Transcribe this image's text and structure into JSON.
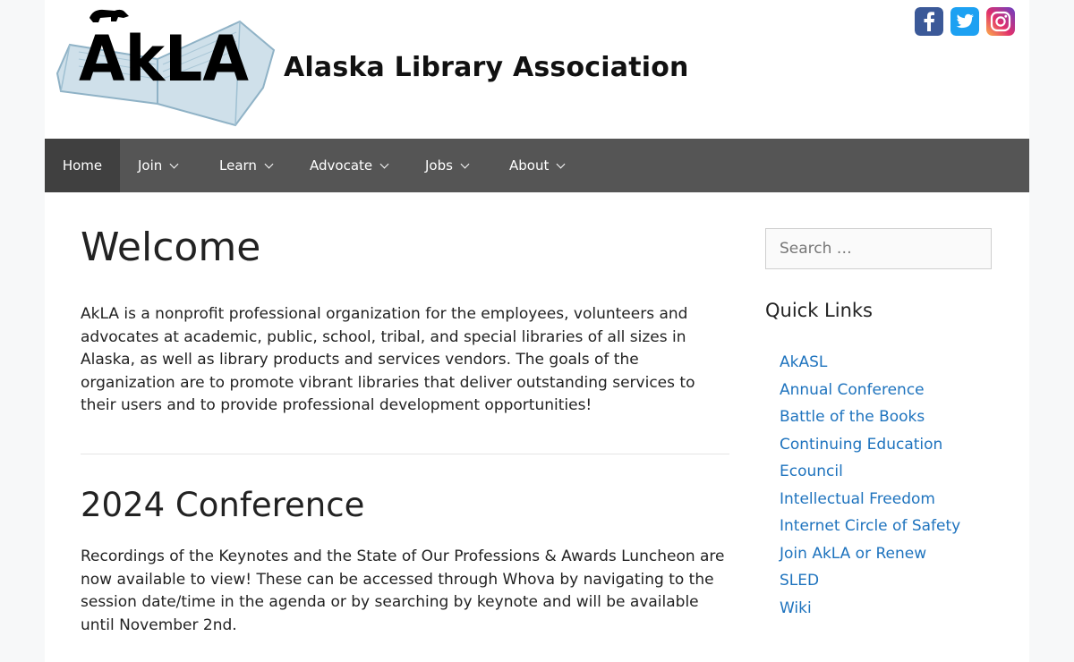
{
  "header": {
    "logo_text": "AkLA",
    "site_title": "Alaska Library Association",
    "social": [
      {
        "name": "facebook",
        "glyph": "f",
        "color": "#3b5998"
      },
      {
        "name": "twitter",
        "glyph": "t",
        "color": "#1da1f2"
      },
      {
        "name": "instagram",
        "glyph": "",
        "color": "#d6249f"
      }
    ]
  },
  "nav": {
    "items": [
      {
        "label": "Home",
        "active": true
      },
      {
        "label": "Join"
      },
      {
        "label": "Learn"
      },
      {
        "label": "Advocate"
      },
      {
        "label": "Jobs"
      },
      {
        "label": "About"
      }
    ]
  },
  "main": {
    "title": "Welcome",
    "intro": "AkLA is a nonprofit professional organization for the employees, volunteers and advocates at academic, public, school, tribal, and special libraries of all sizes in Alaska, as well as library products and services vendors.  The goals of the organization are to promote vibrant libraries that deliver outstanding services to their users and to provide professional development opportunities!",
    "section_title": "2024 Conference",
    "section_text": "Recordings of the Keynotes and the State of Our Professions & Awards Luncheon are now available to view! These can be accessed through Whova by navigating to the session date/time in the agenda or by searching by keynote and will be available until November 2nd."
  },
  "sidebar": {
    "search_placeholder": "Search …",
    "quick_links_title": "Quick Links",
    "links": [
      "AkASL",
      "Annual Conference",
      "Battle of the Books",
      "Continuing Education",
      "Ecouncil",
      "Intellectual Freedom",
      "Internet Circle of Safety",
      "Join AkLA or Renew",
      "SLED",
      "Wiki"
    ]
  },
  "colors": {
    "nav_bg": "#555555",
    "nav_active": "#404040",
    "link": "#1e73be"
  }
}
